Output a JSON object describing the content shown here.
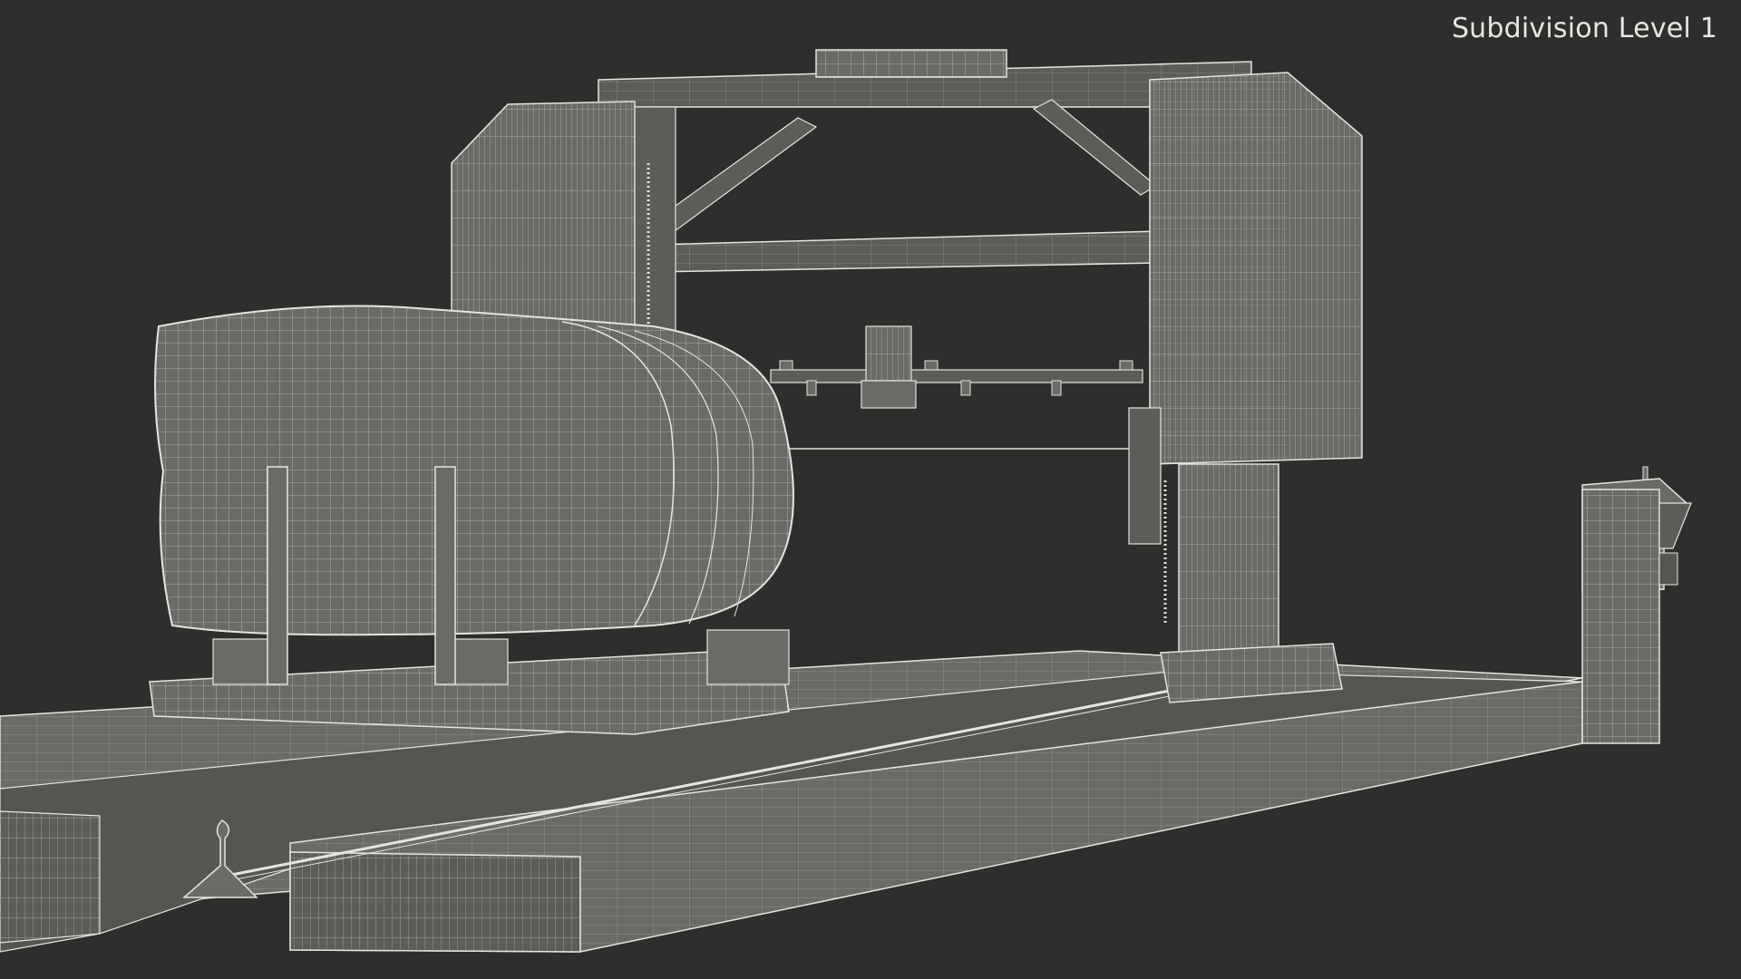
{
  "caption": "Subdivision Level 1",
  "colors": {
    "background": "#2e2e2c",
    "surface": "#6a6b66",
    "surface_dark": "#555651",
    "wire": "#e6e5dd"
  }
}
